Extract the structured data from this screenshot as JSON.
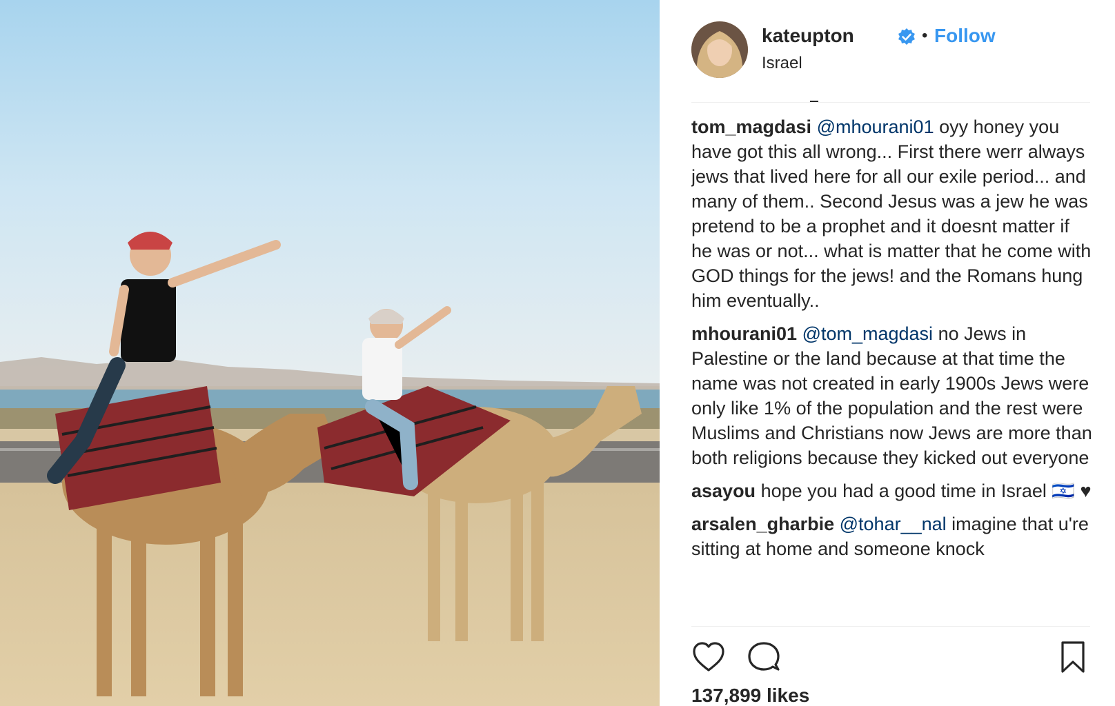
{
  "post": {
    "username": "kateupton",
    "follow_label": "Follow",
    "separator": "•",
    "location": "Israel",
    "likes": "137,899 likes"
  },
  "comments": [
    {
      "author": "tom_magdasi",
      "mention": "@mhourani01",
      "text": " oyy honey you have got this all wrong... First there werr always jews that lived here for all our exile period... and many of them.. Second Jesus was a jew he was pretend to be a prophet and it doesnt matter if he was or not... what is matter that he come with GOD things for the jews! and the Romans hung him eventually.."
    },
    {
      "author": "mhourani01",
      "mention": "@tom_magdasi",
      "text": " no Jews in Palestine or the land because at that time the name was not created in early 1900s Jews were only like 1% of the population and the rest were Muslims and Christians now Jews are more than both religions because they kicked out everyone"
    },
    {
      "author": "asayou",
      "mention": "",
      "text": " hope you had a good time in Israel 🇮🇱 ♥"
    },
    {
      "author": "arsalen_gharbie",
      "mention": "@tohar__nal",
      "text": " imagine that u're sitting at home and someone knock"
    }
  ],
  "icons": {
    "like": "heart-icon",
    "comment": "comment-bubble-icon",
    "save": "bookmark-icon",
    "verified": "verified-badge-icon"
  },
  "colors": {
    "follow": "#3897f0",
    "mention": "#003569",
    "verified": "#3897f0",
    "text": "#262626"
  }
}
